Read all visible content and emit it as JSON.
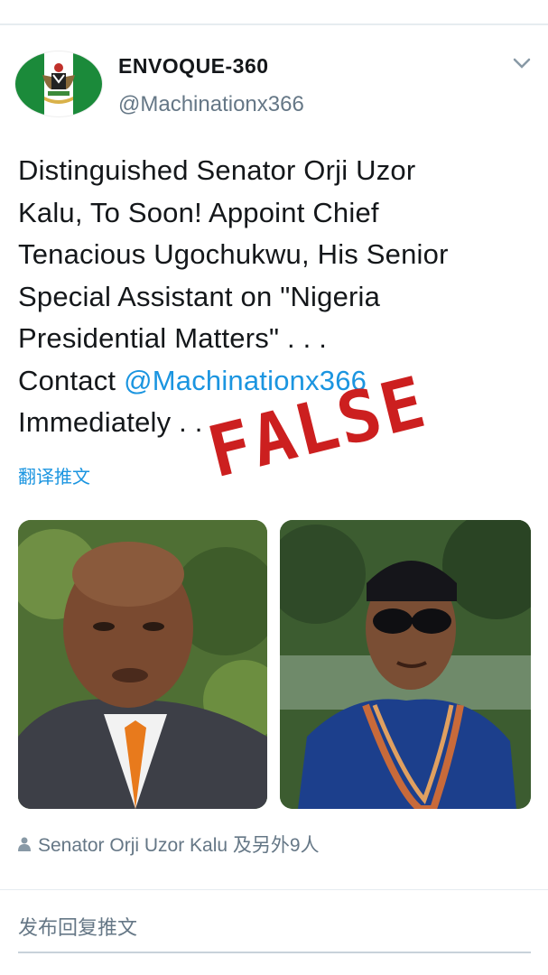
{
  "account": {
    "name": "ENVOQUE-360",
    "handle": "@Machinationx366"
  },
  "tweet": {
    "lines": [
      "Distinguished Senator Orji Uzor",
      "Kalu, To Soon! Appoint Chief",
      "Tenacious Ugochukwu, His Senior",
      "Special Assistant on \"Nigeria",
      "Presidential Matters\" . . ."
    ],
    "contact_prefix": "Contact ",
    "contact_mention": "@Machinationx366",
    "closing": "Immediately . . .",
    "translate_label": "翻译推文"
  },
  "stamp": {
    "text": "FALSE",
    "color": "#cc1f1f"
  },
  "likes": {
    "text": "Senator Orji Uzor Kalu 及另外9人"
  },
  "reply": {
    "placeholder": "发布回复推文"
  },
  "colors": {
    "link": "#1b95e0",
    "secondary_text": "#657786",
    "flag_green": "#1b8a3a"
  }
}
